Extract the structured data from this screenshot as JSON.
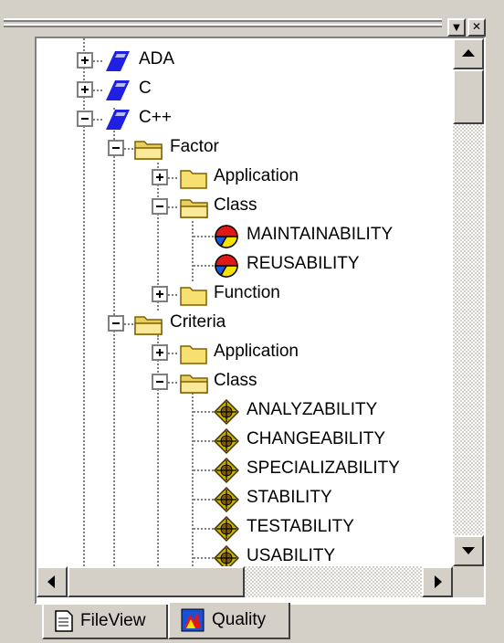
{
  "window_buttons": {
    "dropdown": "▼",
    "close": "✕"
  },
  "tree": {
    "languages": [
      {
        "label": "ADA"
      },
      {
        "label": "C"
      },
      {
        "label": "C++"
      }
    ],
    "factor": {
      "label": "Factor",
      "application": "Application",
      "class": "Class",
      "class_items": [
        "MAINTAINABILITY",
        "REUSABILITY"
      ],
      "function": "Function"
    },
    "criteria": {
      "label": "Criteria",
      "application": "Application",
      "class": "Class",
      "class_items": [
        "ANALYZABILITY",
        "CHANGEABILITY",
        "SPECIALIZABILITY",
        "STABILITY",
        "TESTABILITY",
        "USABILITY"
      ]
    }
  },
  "tabs": [
    {
      "label": "FileView",
      "icon": "fileview-icon"
    },
    {
      "label": "Quality",
      "icon": "quality-icon",
      "active": true
    }
  ],
  "colors": {
    "language_icon": "#2020e0",
    "folder": "#f8e070",
    "factor_red": "#e01818",
    "factor_yellow": "#f8e000",
    "factor_blue": "#1858e0",
    "criteria_icon": "#c8b400"
  }
}
